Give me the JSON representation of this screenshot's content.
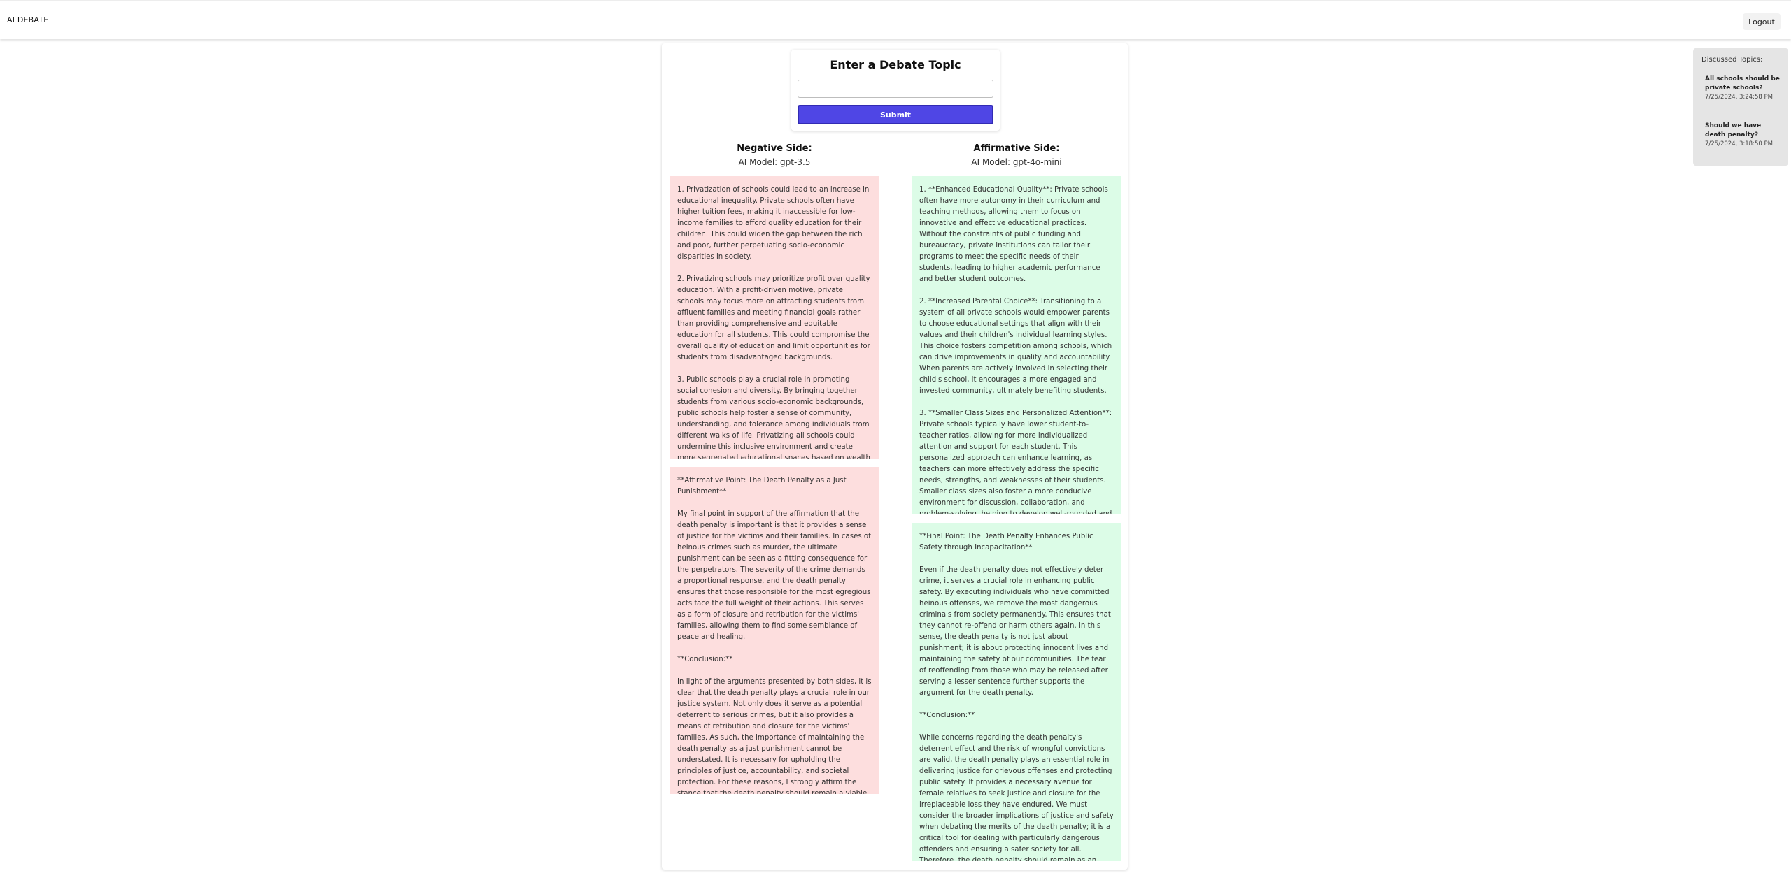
{
  "app": {
    "brand": "AI DEBATE",
    "logout_label": "Logout"
  },
  "topic_form": {
    "title": "Enter a Debate Topic",
    "input_value": "",
    "input_placeholder": "",
    "submit_label": "Submit"
  },
  "negative": {
    "heading": "Negative Side:",
    "model": "AI Model: gpt-3.5",
    "arguments": [
      "1. Privatization of schools could lead to an increase in educational inequality. Private schools often have higher tuition fees, making it inaccessible for low-income families to afford quality education for their children. This could widen the gap between the rich and poor, further perpetuating socio-economic disparities in society.\n\n2. Privatizing schools may prioritize profit over quality education. With a profit-driven motive, private schools may focus more on attracting students from affluent families and meeting financial goals rather than providing comprehensive and equitable education for all students. This could compromise the overall quality of education and limit opportunities for students from disadvantaged backgrounds.\n\n3. Public schools play a crucial role in promoting social cohesion and diversity. By bringing together students from various socio-economic backgrounds, public schools help foster a sense of community, understanding, and tolerance among individuals from different walks of life. Privatizing all schools could undermine this inclusive environment and create more segregated educational spaces based on wealth and privilege.",
      "**Affirmative Point: The Death Penalty as a Just Punishment**\n\nMy final point in support of the affirmation that the death penalty is important is that it provides a sense of justice for the victims and their families. In cases of heinous crimes such as murder, the ultimate punishment can be seen as a fitting consequence for the perpetrators. The severity of the crime demands a proportional response, and the death penalty ensures that those responsible for the most egregious acts face the full weight of their actions. This serves as a form of closure and retribution for the victims' families, allowing them to find some semblance of peace and healing.\n\n**Conclusion:**\n\nIn light of the arguments presented by both sides, it is clear that the death penalty plays a crucial role in our justice system. Not only does it serve as a potential deterrent to serious crimes, but it also provides a means of retribution and closure for the victims' families. As such, the importance of maintaining the death penalty as a just punishment cannot be understated. It is necessary for upholding the principles of justice, accountability, and societal protection. For these reasons, I strongly affirm the stance that the death penalty should remain a viable option in our legal system."
    ]
  },
  "affirmative": {
    "heading": "Affirmative Side:",
    "model": "AI Model: gpt-4o-mini",
    "arguments": [
      "1. **Enhanced Educational Quality**: Private schools often have more autonomy in their curriculum and teaching methods, allowing them to focus on innovative and effective educational practices. Without the constraints of public funding and bureaucracy, private institutions can tailor their programs to meet the specific needs of their students, leading to higher academic performance and better student outcomes.\n\n2. **Increased Parental Choice**: Transitioning to a system of all private schools would empower parents to choose educational settings that align with their values and their children's individual learning styles. This choice fosters competition among schools, which can drive improvements in quality and accountability. When parents are actively involved in selecting their child's school, it encourages a more engaged and invested community, ultimately benefiting students.\n\n3. **Smaller Class Sizes and Personalized Attention**: Private schools typically have lower student-to-teacher ratios, allowing for more individualized attention and support for each student. This personalized approach can enhance learning, as teachers can more effectively address the specific needs, strengths, and weaknesses of their students. Smaller class sizes also foster a more conducive environment for discussion, collaboration, and problem-solving, helping to develop well-rounded and critical thinkers.",
      "**Final Point: The Death Penalty Enhances Public Safety through Incapacitation**\n\nEven if the death penalty does not effectively deter crime, it serves a crucial role in enhancing public safety. By executing individuals who have committed heinous offenses, we remove the most dangerous criminals from society permanently. This ensures that they cannot re-offend or harm others again. In this sense, the death penalty is not just about punishment; it is about protecting innocent lives and maintaining the safety of our communities. The fear of reoffending from those who may be released after serving a lesser sentence further supports the argument for the death penalty.\n\n**Conclusion:**\n\nWhile concerns regarding the death penalty's deterrent effect and the risk of wrongful convictions are valid, the death penalty plays an essential role in delivering justice for grievous offenses and protecting public safety. It provides a necessary avenue for female relatives to seek justice and closure for the irreplaceable loss they have endured. We must consider the broader implications of justice and safety when debating the merits of the death penalty; it is a critical tool for dealing with particularly dangerous offenders and ensuring a safer society for all. Therefore, the death penalty should remain as an option for the most serious crimes."
    ]
  },
  "discussed_topics": {
    "header": "Discussed Topics:",
    "items": [
      {
        "title": "All schools should be private schools?",
        "date": "7/25/2024, 3:24:58 PM"
      },
      {
        "title": "Should we have death penalty?",
        "date": "7/25/2024, 3:18:50 PM"
      }
    ]
  }
}
